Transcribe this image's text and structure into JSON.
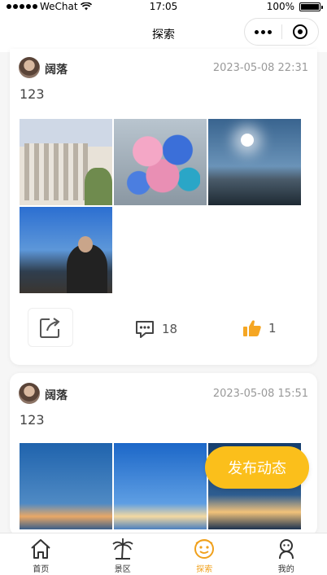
{
  "status_bar": {
    "carrier": "WeChat",
    "time": "17:05",
    "battery": "100%"
  },
  "nav": {
    "title": "探索"
  },
  "posts": [
    {
      "username": "阔落",
      "datetime": "2023-05-08 22:31",
      "text": "123",
      "comment_count": "18",
      "like_count": "1"
    },
    {
      "username": "阔落",
      "datetime": "2023-05-08 15:51",
      "text": "123"
    }
  ],
  "fab": {
    "label": "发布动态"
  },
  "tabbar": {
    "items": [
      {
        "label": "首页",
        "icon": "home-icon"
      },
      {
        "label": "景区",
        "icon": "palm-tree-icon"
      },
      {
        "label": "探索",
        "icon": "explore-face-icon"
      },
      {
        "label": "我的",
        "icon": "user-icon"
      }
    ],
    "active_index": 2,
    "active_color": "#f0a01b"
  },
  "colors": {
    "accent": "#fbbf1b",
    "like": "#f5a623"
  }
}
